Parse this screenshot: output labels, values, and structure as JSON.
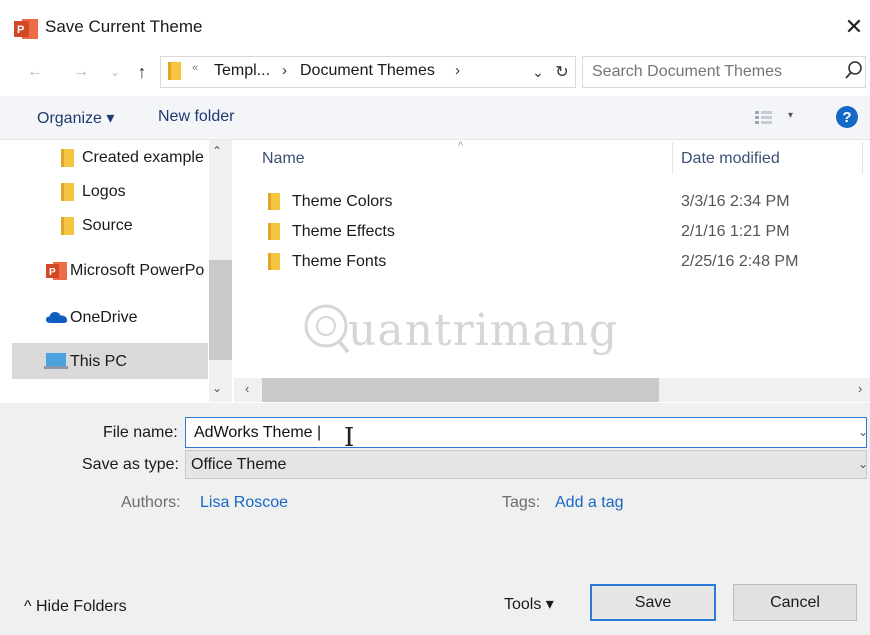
{
  "window": {
    "title": "Save Current Theme",
    "close_glyph": "✕",
    "app_icon": "powerpoint-icon"
  },
  "addressbar": {
    "back_glyph": "←",
    "forward_glyph": "→",
    "recent_glyph": "⌄",
    "up_glyph": "↑",
    "more_glyph": "«",
    "crumbs": [
      "Templ...",
      "Document Themes"
    ],
    "separator": "›",
    "dropdown_glyph": "⌄",
    "refresh_glyph": "↻"
  },
  "search": {
    "placeholder": "Search Document Themes",
    "icon": "search-icon"
  },
  "toolbar": {
    "organize_label": "Organize ▾",
    "new_folder_label": "New folder",
    "view_arrow": "▾",
    "help_label": "?"
  },
  "navpane": {
    "items": [
      {
        "label": "Created example",
        "icon": "folder-icon"
      },
      {
        "label": "Logos",
        "icon": "folder-icon"
      },
      {
        "label": "Source",
        "icon": "folder-icon"
      },
      {
        "label": "Microsoft PowerPo",
        "icon": "powerpoint-icon"
      },
      {
        "label": "OneDrive",
        "icon": "onedrive-icon"
      },
      {
        "label": "This PC",
        "icon": "computer-icon"
      }
    ],
    "selected": "This PC",
    "scroll_up": "⌃",
    "scroll_down": "⌄"
  },
  "filelist": {
    "columns": {
      "name": "Name",
      "date": "Date modified"
    },
    "sort_glyph": "^",
    "rows": [
      {
        "name": "Theme Colors",
        "date": "3/3/16 2:34 PM"
      },
      {
        "name": "Theme Effects",
        "date": "2/1/16 1:21 PM"
      },
      {
        "name": "Theme Fonts",
        "date": "2/25/16 2:48 PM"
      }
    ],
    "hscroll_left": "‹",
    "hscroll_right": "›"
  },
  "watermark": {
    "text": "uantrimang"
  },
  "form": {
    "file_name_label": "File name:",
    "file_name_value": "AdWorks Theme |",
    "save_as_type_label": "Save as type:",
    "save_as_type_value": "Office Theme",
    "caret_glyph": "⌄",
    "authors_label": "Authors:",
    "authors_value": "Lisa Roscoe",
    "tags_label": "Tags:",
    "tags_value": "Add a tag",
    "ibeam_glyph": "I"
  },
  "footer": {
    "hide_folders_label": "^ Hide Folders",
    "tools_label": "Tools ▾",
    "save_label": "Save",
    "cancel_label": "Cancel"
  },
  "colors": {
    "accent": "#1469c7",
    "link": "#1767c4",
    "selection": "#d9d9d9",
    "folder": "#f5c542",
    "powerpoint": "#d24726"
  }
}
